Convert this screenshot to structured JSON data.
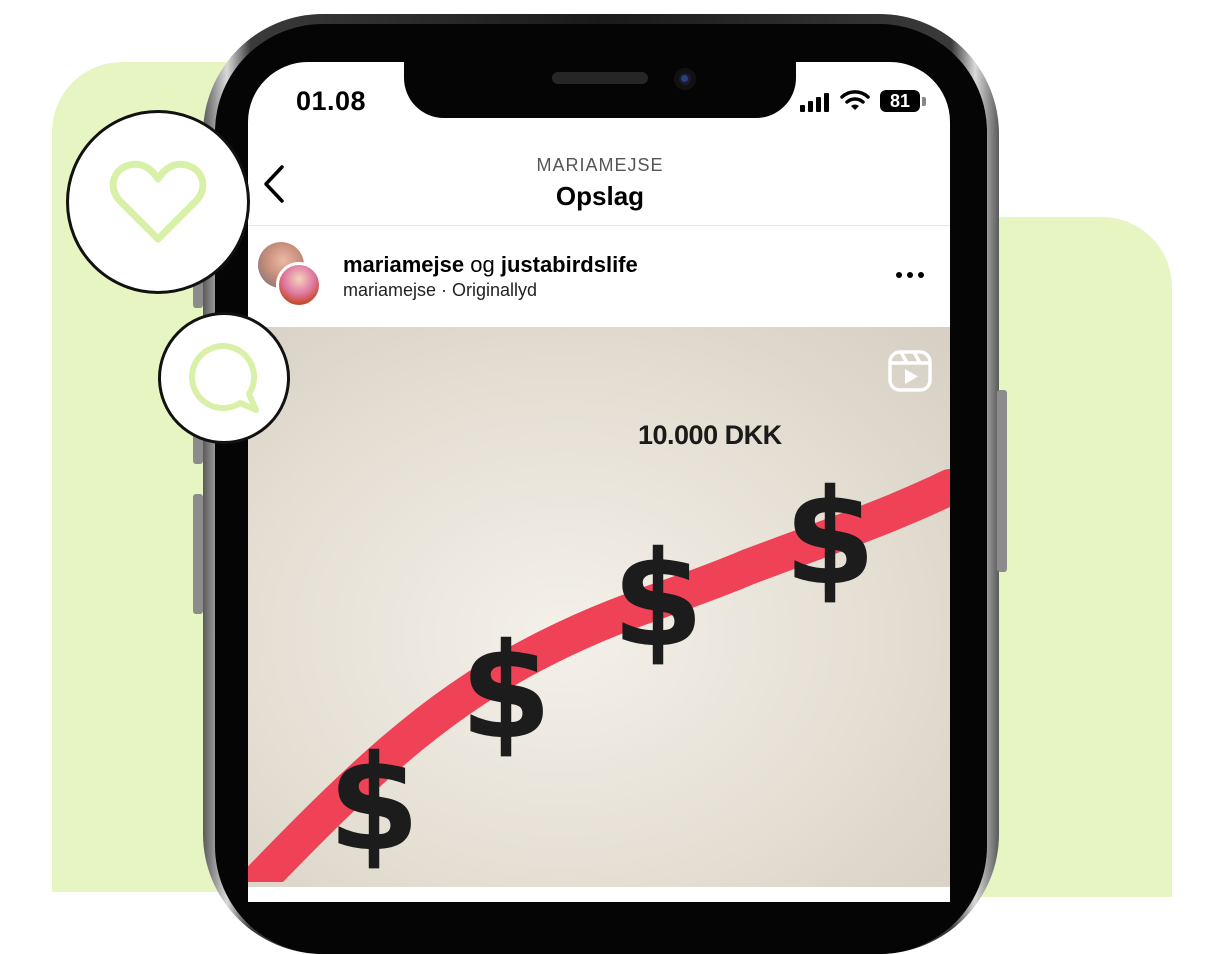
{
  "status_bar": {
    "time": "01.08",
    "battery": "81"
  },
  "header": {
    "subtitle": "MARIAMEJSE",
    "title": "Opslag"
  },
  "post": {
    "author": "mariamejse",
    "connector": "og",
    "collaborator": "justabirdslife",
    "audio_line": "mariamejse · Originallyd"
  },
  "media": {
    "overlay_text": "10.000 DKK",
    "dollar_symbol": "$"
  },
  "icons": {
    "back": "chevron-left-icon",
    "more": "more-horizontal-icon",
    "reels": "reels-icon",
    "heart": "heart-icon",
    "comment": "comment-icon",
    "signal": "cellular-signal-icon",
    "wifi": "wifi-icon",
    "battery": "battery-icon"
  },
  "colors": {
    "background_accent": "#e6f5c2",
    "icon_accent": "#d9f0a8",
    "curve": "#ef4257"
  }
}
